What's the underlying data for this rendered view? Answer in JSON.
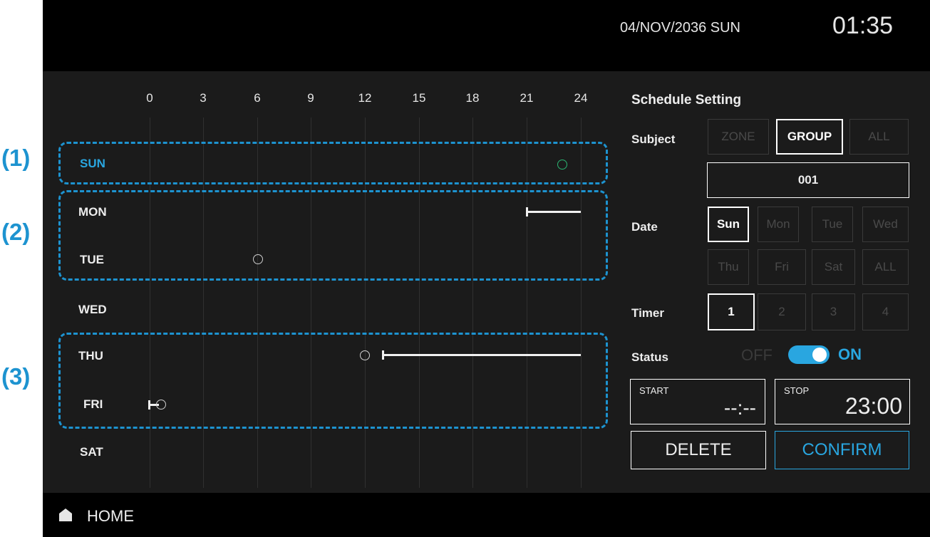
{
  "header": {
    "date": "04/NOV/2036  SUN",
    "time": "01:35"
  },
  "hours": [
    "0",
    "3",
    "6",
    "9",
    "12",
    "15",
    "18",
    "21",
    "24"
  ],
  "days": [
    "SUN",
    "MON",
    "TUE",
    "WED",
    "THU",
    "FRI",
    "SAT"
  ],
  "callouts": [
    "(1)",
    "(2)",
    "(3)"
  ],
  "panel": {
    "title": "Schedule Setting",
    "subject_label": "Subject",
    "subject_options": [
      "ZONE",
      "GROUP",
      "ALL"
    ],
    "subject_selected": "GROUP",
    "group_number": "001",
    "date_label": "Date",
    "date_options": [
      "Sun",
      "Mon",
      "Tue",
      "Wed",
      "Thu",
      "Fri",
      "Sat",
      "ALL"
    ],
    "date_selected": "Sun",
    "timer_label": "Timer",
    "timer_options": [
      "1",
      "2",
      "3",
      "4"
    ],
    "timer_selected": "1",
    "status_label": "Status",
    "status_off": "OFF",
    "status_on": "ON",
    "status_value": "ON",
    "start_label": "START",
    "start_value": "--:--",
    "stop_label": "STOP",
    "stop_value": "23:00",
    "delete_label": "DELETE",
    "confirm_label": "CONFIRM"
  },
  "footer": {
    "home_label": "HOME"
  },
  "colors": {
    "accent": "#29a6e0",
    "callout": "#1d93d0",
    "on_marker": "#2bb673"
  }
}
